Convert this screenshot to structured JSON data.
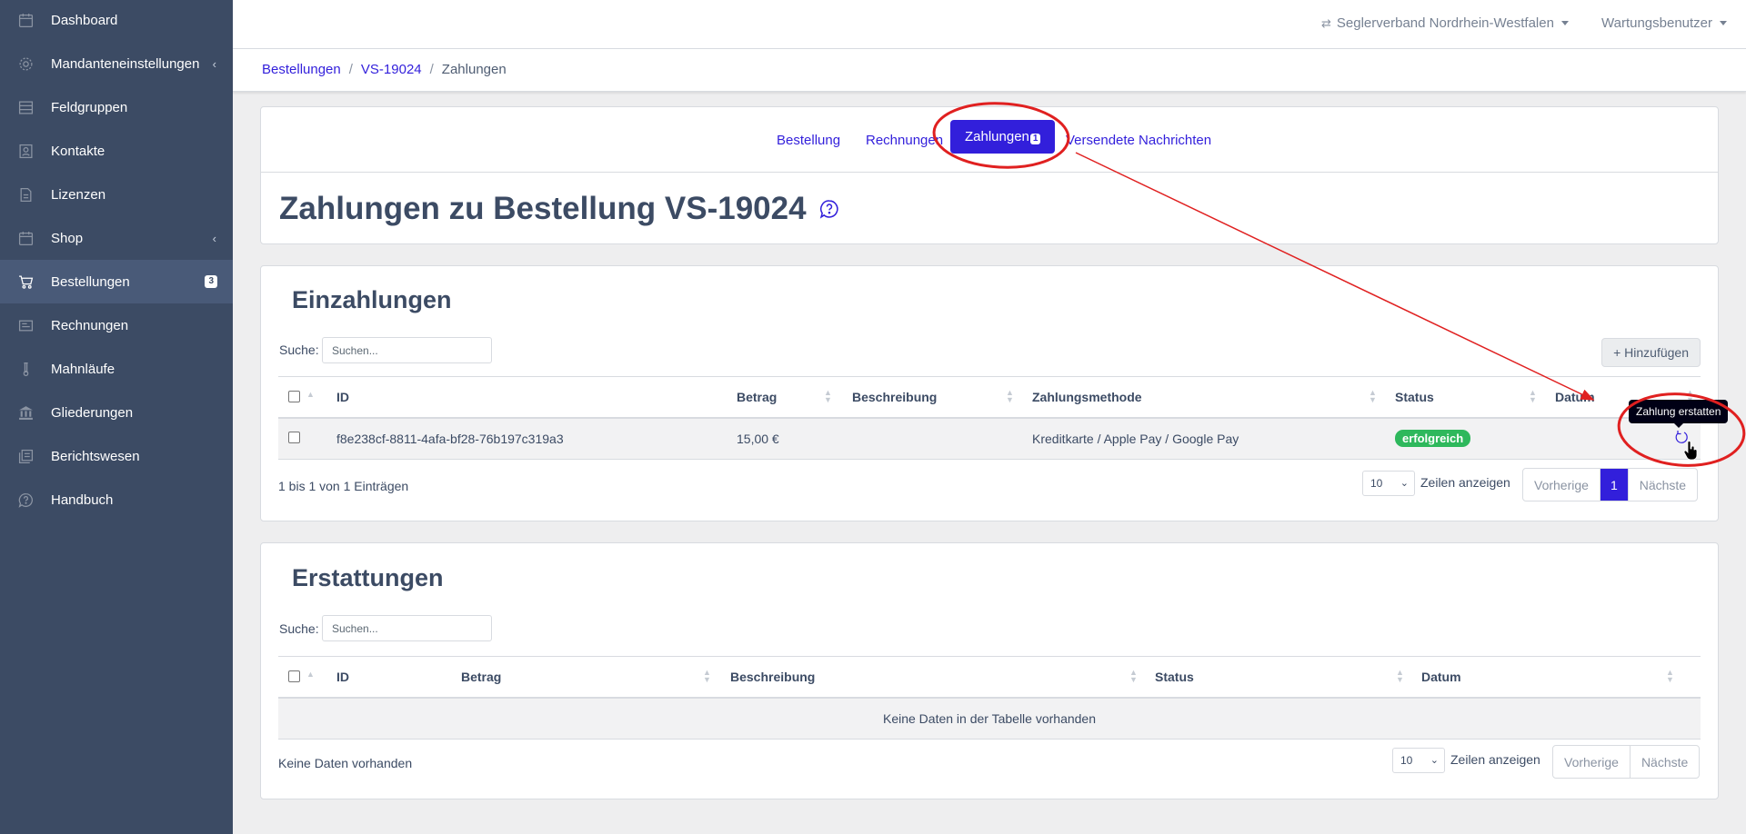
{
  "sidebar": {
    "items": [
      {
        "label": "Dashboard",
        "icon": "calendar-icon"
      },
      {
        "label": "Mandanteneinstellungen",
        "icon": "gear-icon",
        "chevron": "‹"
      },
      {
        "label": "Feldgruppen",
        "icon": "list-icon"
      },
      {
        "label": "Kontakte",
        "icon": "contact-icon"
      },
      {
        "label": "Lizenzen",
        "icon": "document-icon"
      },
      {
        "label": "Shop",
        "icon": "shop-icon",
        "chevron": "‹"
      },
      {
        "label": "Bestellungen",
        "icon": "cart-icon",
        "badge": "3",
        "active": true
      },
      {
        "label": "Rechnungen",
        "icon": "invoice-icon"
      },
      {
        "label": "Mahnläufe",
        "icon": "flask-icon"
      },
      {
        "label": "Gliederungen",
        "icon": "bank-icon"
      },
      {
        "label": "Berichtswesen",
        "icon": "library-icon"
      },
      {
        "label": "Handbuch",
        "icon": "help-icon"
      }
    ]
  },
  "header": {
    "organization": "Seglerverband Nordrhein-Westfalen",
    "user": "Wartungsbenutzer"
  },
  "breadcrumb": {
    "orders": "Bestellungen",
    "order_id": "VS-19024",
    "current": "Zahlungen"
  },
  "tabs": {
    "order": "Bestellung",
    "invoices": "Rechnungen",
    "payments": "Zahlungen",
    "payments_badge": "1",
    "messages": "Versendete Nachrichten"
  },
  "page": {
    "title": "Zahlungen zu Bestellung VS-19024"
  },
  "deposits": {
    "title": "Einzahlungen",
    "search_label": "Suche:",
    "search_placeholder": "Suchen...",
    "add_label": "+ Hinzufügen",
    "columns": [
      "ID",
      "Betrag",
      "Beschreibung",
      "Zahlungsmethode",
      "Status",
      "Datum"
    ],
    "rows": [
      {
        "id": "f8e238cf-8811-4afa-bf28-76b197c319a3",
        "amount": "15,00 €",
        "description": "",
        "method": "Kreditkarte / Apple Pay / Google Pay",
        "status": "erfolgreich"
      }
    ],
    "info": "1 bis 1 von 1 Einträgen",
    "page_length": "10",
    "page_length_label": "Zeilen anzeigen",
    "prev": "Vorherige",
    "current_page": "1",
    "next": "Nächste",
    "refund_tooltip": "Zahlung erstatten"
  },
  "refunds": {
    "title": "Erstattungen",
    "search_label": "Suche:",
    "search_placeholder": "Suchen...",
    "columns": [
      "ID",
      "Betrag",
      "Beschreibung",
      "Status",
      "Datum"
    ],
    "empty_message": "Keine Daten in der Tabelle vorhanden",
    "info": "Keine Daten vorhanden",
    "page_length": "10",
    "page_length_label": "Zeilen anzeigen",
    "prev": "Vorherige",
    "next": "Nächste"
  },
  "colors": {
    "sidebar": "#3c4b64",
    "primary": "#321fdb",
    "success": "#2eb85c",
    "annotation": "#e02020"
  }
}
